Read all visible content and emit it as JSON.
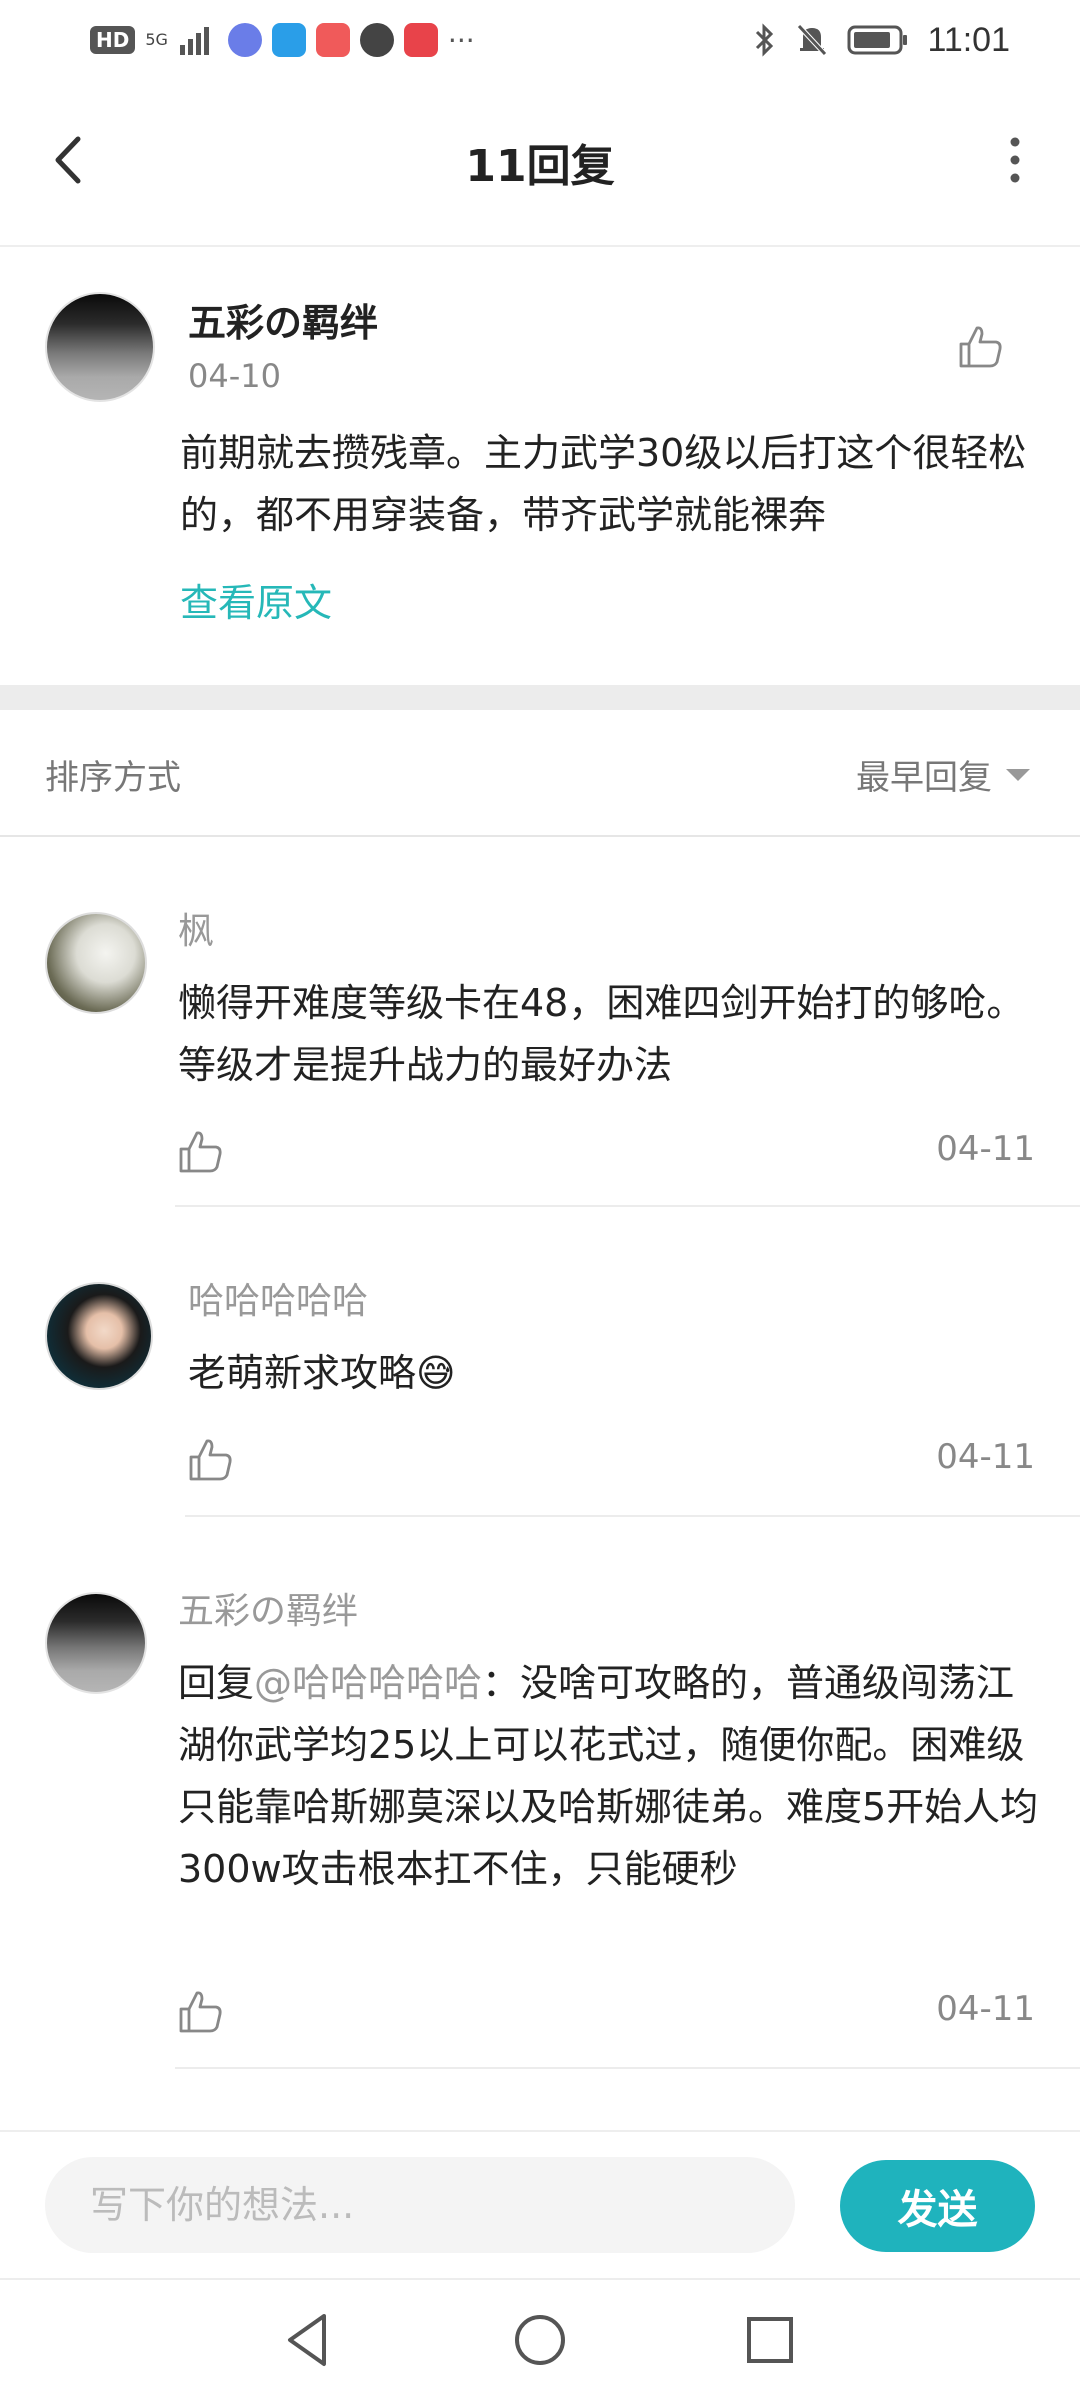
{
  "status_bar": {
    "hd_badge": "HD",
    "network": "5G",
    "time": "11:01",
    "more": "···"
  },
  "header": {
    "title": "11回复"
  },
  "main_comment": {
    "author": "五彩の羁绊",
    "date": "04-10",
    "text": "前期就去攒残章。主力武学30级以后打这个很轻松的，都不用穿装备，带齐武学就能裸奔",
    "view_original": "查看原文"
  },
  "sort": {
    "label": "排序方式",
    "selected": "最早回复"
  },
  "replies": [
    {
      "author": "枫",
      "text": "懒得开难度等级卡在48，困难四剑开始打的够呛。等级才是提升战力的最好办法",
      "date": "04-11"
    },
    {
      "author": "哈哈哈哈哈",
      "text": "老萌新求攻略😅",
      "date": "04-11"
    },
    {
      "author": "五彩の羁绊",
      "reply_prefix": "回复",
      "mention": "@哈哈哈哈哈",
      "text": "：没啥可攻略的，普通级闯荡江湖你武学均25以上可以花式过，随便你配。困难级只能靠哈斯娜莫深以及哈斯娜徒弟。难度5开始人均300w攻击根本扛不住，只能硬秒",
      "date": "04-11"
    }
  ],
  "composer": {
    "placeholder": "写下你的想法...",
    "send_label": "发送"
  },
  "colors": {
    "accent": "#1fb3bd",
    "link": "#26b8b8"
  }
}
